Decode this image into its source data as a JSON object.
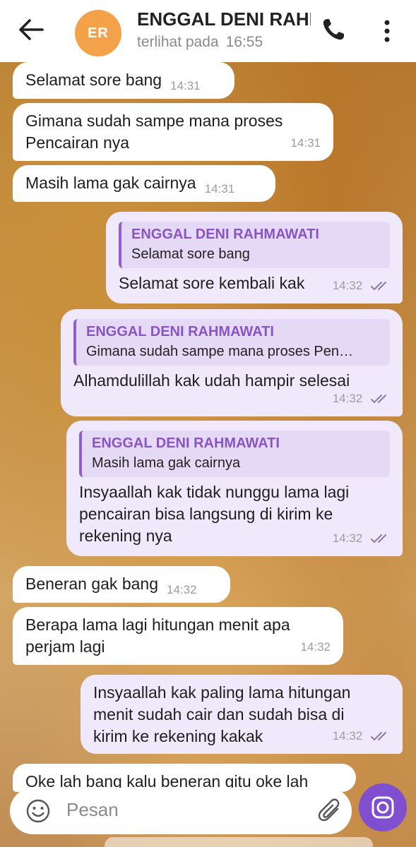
{
  "header": {
    "avatar_initials": "ER",
    "contact_name": "ENGGAL DENI RAHMAWATI",
    "last_seen_label": "terlihat pada",
    "last_seen_time": "16:55",
    "avatar_color": "#f3a24a"
  },
  "messages": [
    {
      "direction": "in",
      "text": "Selamat sore bang",
      "time": "14:31"
    },
    {
      "direction": "in",
      "line1": "Gimana sudah sampe mana proses",
      "line2": "Pencairan nya",
      "time": "14:31"
    },
    {
      "direction": "in",
      "text": "Masih lama gak cairnya",
      "time": "14:31"
    },
    {
      "direction": "out",
      "quote_name": "ENGGAL DENI RAHMAWATI",
      "quote_text": "Selamat sore bang",
      "text": "Selamat sore kembali kak",
      "time": "14:32",
      "status": "read"
    },
    {
      "direction": "out",
      "quote_name": "ENGGAL DENI RAHMAWATI",
      "quote_text": "Gimana sudah sampe mana proses Pen…",
      "text": "Alhamdulillah kak udah hampir selesai",
      "time": "14:32",
      "status": "read"
    },
    {
      "direction": "out",
      "quote_name": "ENGGAL DENI RAHMAWATI",
      "quote_text": "Masih lama gak cairnya",
      "line1": "Insyaallah kak tidak nunggu lama lagi",
      "line2": "pencairan bisa langsung di kirim ke",
      "line3": "rekening nya",
      "time": "14:32",
      "status": "read"
    },
    {
      "direction": "in",
      "text": "Beneran gak bang",
      "time": "14:32"
    },
    {
      "direction": "in",
      "line1": "Berapa lama lagi hitungan menit apa",
      "line2": "perjam lagi",
      "time": "14:32"
    },
    {
      "direction": "out",
      "line1": "Insyaallah kak paling lama hitungan",
      "line2": "menit sudah cair dan sudah bisa di",
      "line3": "kirim ke rekening kakak",
      "time": "14:32",
      "status": "read"
    },
    {
      "direction": "in",
      "text": "Oke lah bang kalu beneran gitu oke lah"
    }
  ],
  "composer": {
    "placeholder": "Pesan"
  },
  "colors": {
    "accent": "#7f4fcf",
    "outgoing_bubble": "#efe9fb",
    "quote_name": "#8a55c1"
  }
}
